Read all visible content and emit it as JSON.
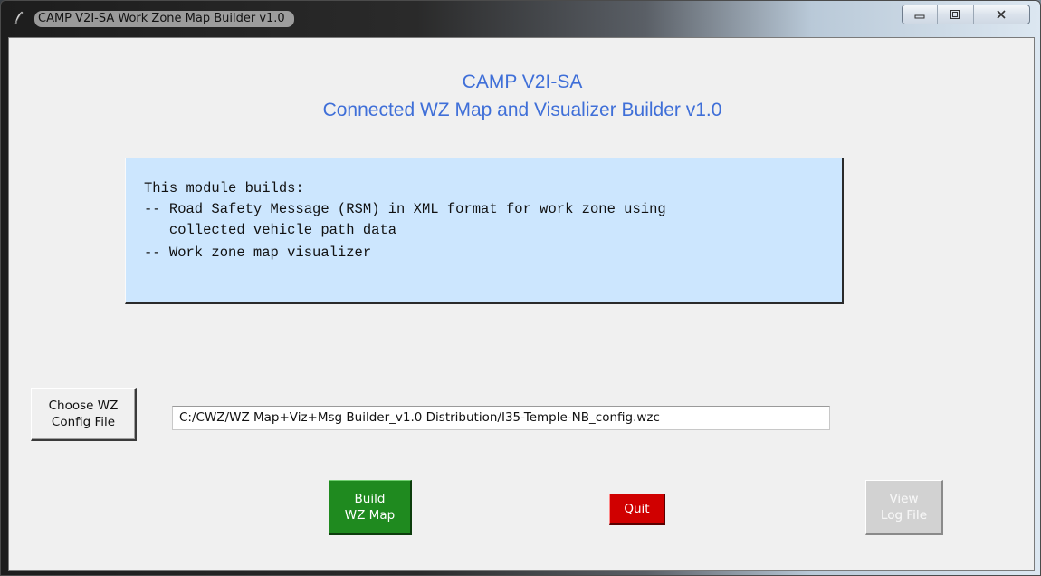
{
  "window": {
    "title": "CAMP V2I-SA Work Zone Map Builder v1.0",
    "icon": "feather-icon",
    "controls": [
      "minimize-icon",
      "maximize-icon",
      "close-icon"
    ]
  },
  "header": {
    "line1": "CAMP V2I-SA",
    "line2": "Connected WZ Map and Visualizer Builder v1.0",
    "color": "#3f6fd8"
  },
  "info": {
    "lines": [
      "This module builds:",
      "-- Road Safety Message (RSM) in XML format for work zone using",
      "   collected vehicle path data",
      "-- Work zone map visualizer"
    ],
    "background": "#cce6fe"
  },
  "config": {
    "choose_line1": "Choose WZ",
    "choose_line2": "Config File",
    "path_value": "C:/CWZ/WZ Map+Viz+Msg Builder_v1.0 Distribution/I35-Temple-NB_config.wzc"
  },
  "actions": {
    "build_line1": "Build",
    "build_line2": "WZ Map",
    "build_color": "#1f8a1f",
    "quit_label": "Quit",
    "quit_color": "#d00000",
    "log_line1": "View",
    "log_line2": "Log File",
    "log_enabled": false
  }
}
